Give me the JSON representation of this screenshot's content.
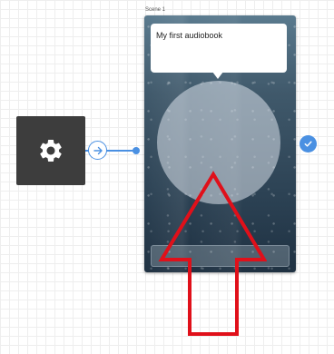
{
  "scene": {
    "label": "Scene 1"
  },
  "bubble": {
    "text": "My first audiobook"
  },
  "icons": {
    "settings": "gear-icon",
    "connector": "arrow-right-icon",
    "complete": "check-icon",
    "annotation": "arrow-up-icon"
  },
  "colors": {
    "accent": "#4a90e2",
    "node": "#3d3d3d",
    "annotation": "#e0101a"
  }
}
